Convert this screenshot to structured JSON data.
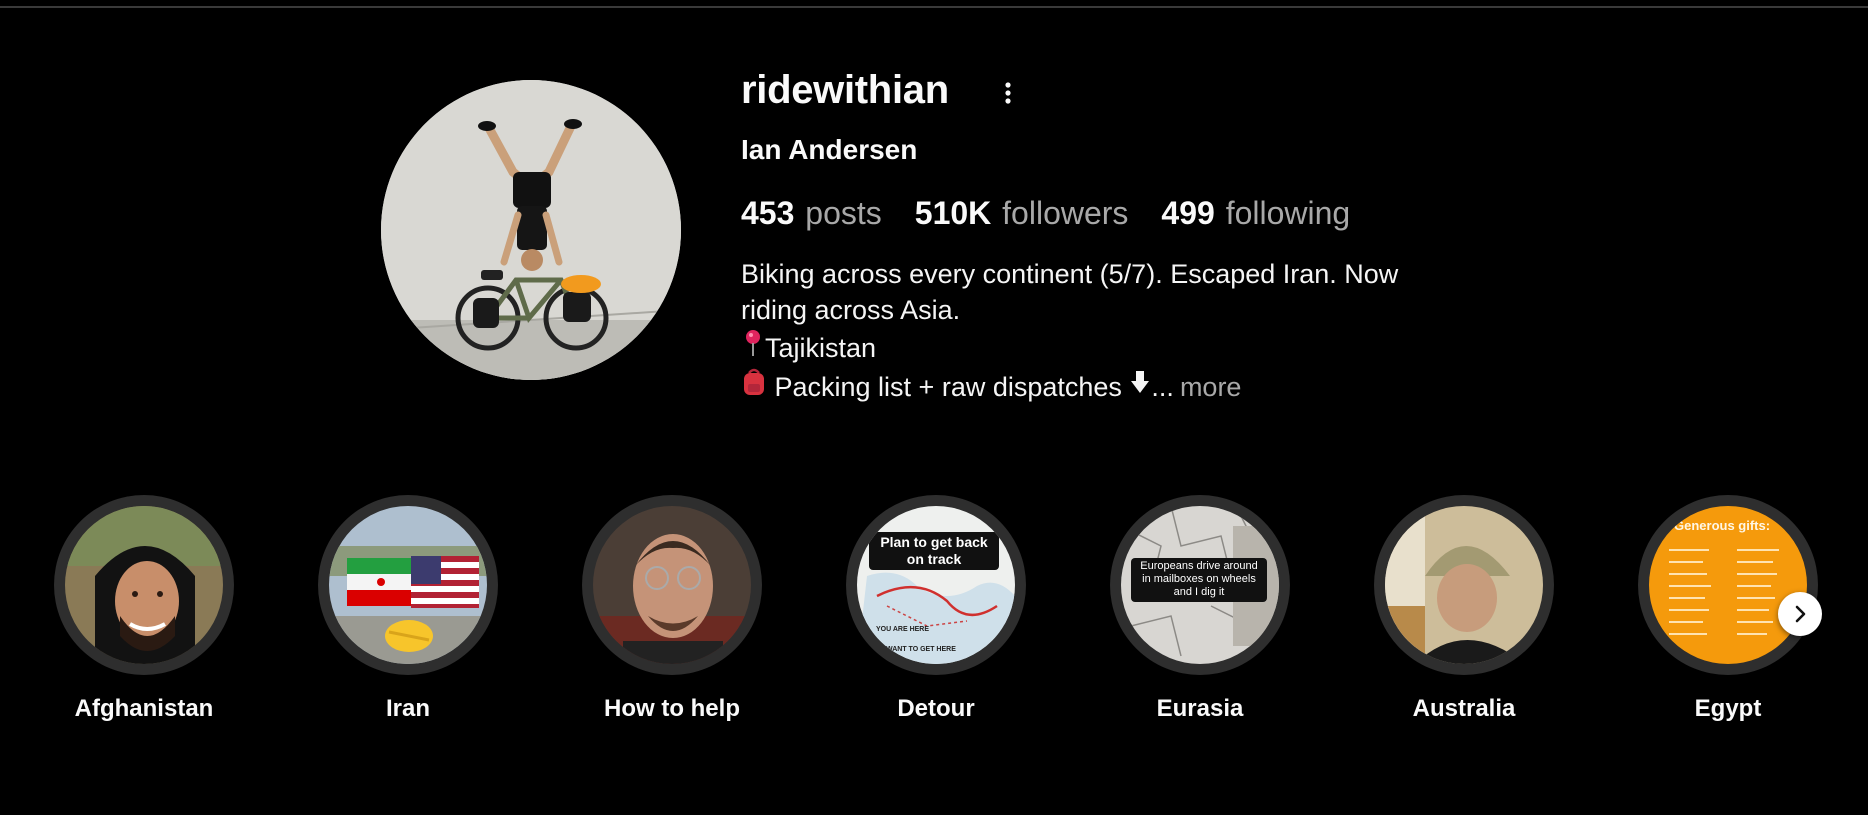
{
  "profile": {
    "username": "ridewithian",
    "full_name": "Ian Andersen",
    "stats": {
      "posts_count": "453",
      "posts_label": "posts",
      "followers_count": "510K",
      "followers_label": "followers",
      "following_count": "499",
      "following_label": "following"
    },
    "bio": {
      "line1": "Biking across every continent (5/7). Escaped Iran. Now",
      "line2": "riding across Asia.",
      "line3": "Tajikistan",
      "line4": " Packing list + raw dispatches ",
      "line4_tail": "...",
      "more_label": "more"
    },
    "icons": {
      "options": "more-options-icon",
      "pin": "round-pushpin-icon",
      "bag": "backpack-icon",
      "arrow": "down-arrow-icon"
    }
  },
  "highlights": [
    {
      "label": "Afghanistan"
    },
    {
      "label": "Iran"
    },
    {
      "label": "How to help"
    },
    {
      "label": "Detour",
      "overlay_text": "Plan to get back on track",
      "small_text_1": "YOU ARE HERE",
      "small_text_2": "WANT TO GET HERE"
    },
    {
      "label": "Eurasia",
      "overlay_text": "Europeans drive around in mailboxes on wheels and I dig it"
    },
    {
      "label": "Australia"
    },
    {
      "label": "Egypt",
      "overlay_text": "Generous gifts:"
    }
  ],
  "nav": {
    "next_icon": "chevron-right-icon"
  },
  "colors": {
    "background": "#000000",
    "text_primary": "#fafafa",
    "text_secondary": "#a8a8a8",
    "highlight_ring": "#2e2e2e",
    "egypt_orange": "#f59a0c"
  }
}
